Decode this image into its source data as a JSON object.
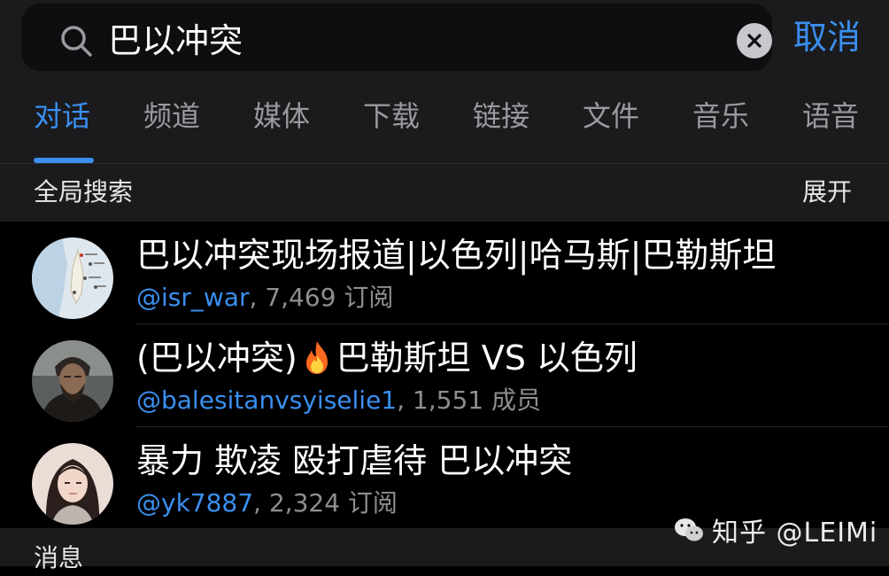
{
  "search": {
    "query": "巴以冲突",
    "cancel_label": "取消"
  },
  "tabs": [
    {
      "label": "对话"
    },
    {
      "label": "频道"
    },
    {
      "label": "媒体"
    },
    {
      "label": "下载"
    },
    {
      "label": "链接"
    },
    {
      "label": "文件"
    },
    {
      "label": "音乐"
    },
    {
      "label": "语音"
    }
  ],
  "global_search": {
    "title": "全局搜索",
    "expand_label": "展开"
  },
  "results": [
    {
      "title": "巴以冲突现场报道|以色列|哈马斯|巴勒斯坦",
      "handle": "@isr_war",
      "count": ", 7,469 订阅",
      "avatar_icon": "map-avatar-icon"
    },
    {
      "title_pre": "(巴以冲突)",
      "title_post": "巴勒斯坦 VS 以色列",
      "title_emoji": "fire-emoji",
      "handle": "@balesitanvsyiselie1",
      "count": ", 1,551 成员",
      "avatar_icon": "man-portrait-avatar"
    },
    {
      "title": "暴力 欺凌 殴打虐待 巴以冲突",
      "handle": "@yk7887",
      "count": ", 2,324 订阅",
      "avatar_icon": "woman-portrait-avatar"
    }
  ],
  "messages": {
    "title": "消息"
  },
  "watermark": {
    "text": "知乎 @LEIMi"
  },
  "colors": {
    "accent": "#3a8ff0",
    "background": "#000000",
    "panel": "#1b1b1d"
  }
}
